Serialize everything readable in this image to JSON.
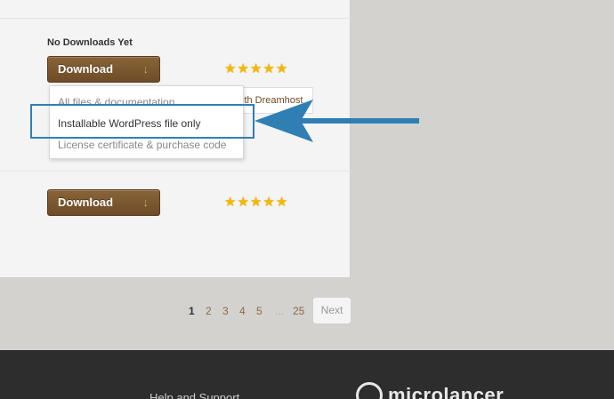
{
  "item1": {
    "status": "No Downloads Yet",
    "download_label": "Download",
    "download_icon": "down-arrow-icon",
    "rating_stars": 5
  },
  "dreamhost_button": {
    "label": "ith Dreamhost"
  },
  "dropdown": {
    "items": [
      {
        "label": "All files & documentation"
      },
      {
        "label": "Installable WordPress file only"
      },
      {
        "label": "License certificate & purchase code"
      }
    ]
  },
  "item2": {
    "download_label": "Download",
    "rating_stars": 5
  },
  "pagination": {
    "pages": [
      "1",
      "2",
      "3",
      "4",
      "5",
      "...",
      "25"
    ],
    "current": "1",
    "next_label": "Next"
  },
  "footer": {
    "help_link": "Help and Support",
    "logo_text": "microlancer"
  },
  "colors": {
    "button_brown": "#7a5530",
    "annotation_blue": "#2f7fb5",
    "star_yellow": "#f5b800",
    "footer_bg": "#2d2d2d"
  }
}
